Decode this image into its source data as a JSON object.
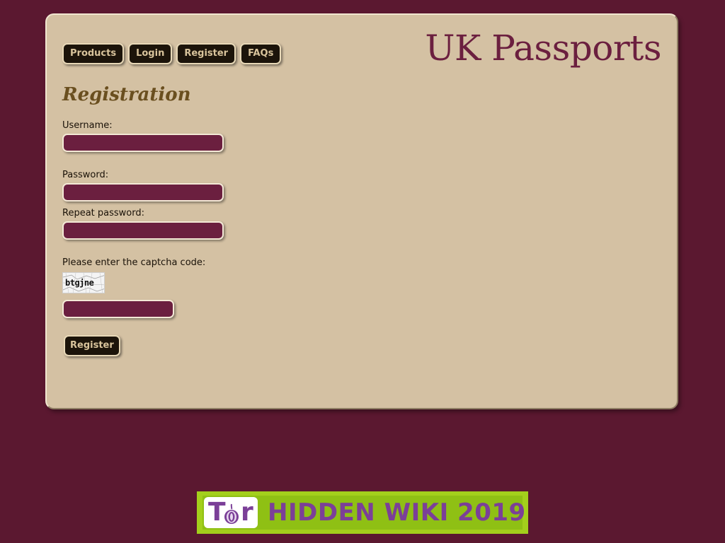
{
  "site": {
    "title": "UK Passports"
  },
  "nav": {
    "items": [
      {
        "label": "Products"
      },
      {
        "label": "Login"
      },
      {
        "label": "Register"
      },
      {
        "label": "FAQs"
      }
    ]
  },
  "form": {
    "heading": "Registration",
    "username_label": "Username:",
    "username_value": "",
    "password_label": "Password:",
    "password_value": "",
    "repeat_password_label": "Repeat password:",
    "repeat_password_value": "",
    "captcha_label": "Please enter the captcha code:",
    "captcha_text": "btgjne",
    "captcha_value": "",
    "submit_label": "Register"
  },
  "banner": {
    "logo_text_t": "T",
    "logo_text_r": "r",
    "text": "HIDDEN WIKI 2019"
  },
  "colors": {
    "background": "#5b1830",
    "panel": "#d4c1a3",
    "title": "#6b1f3f",
    "heading": "#6a4f1f",
    "button": "#1c140a",
    "input": "#6b1f3f",
    "banner_green": "#a3cf1c",
    "banner_purple": "#7b3f98"
  }
}
